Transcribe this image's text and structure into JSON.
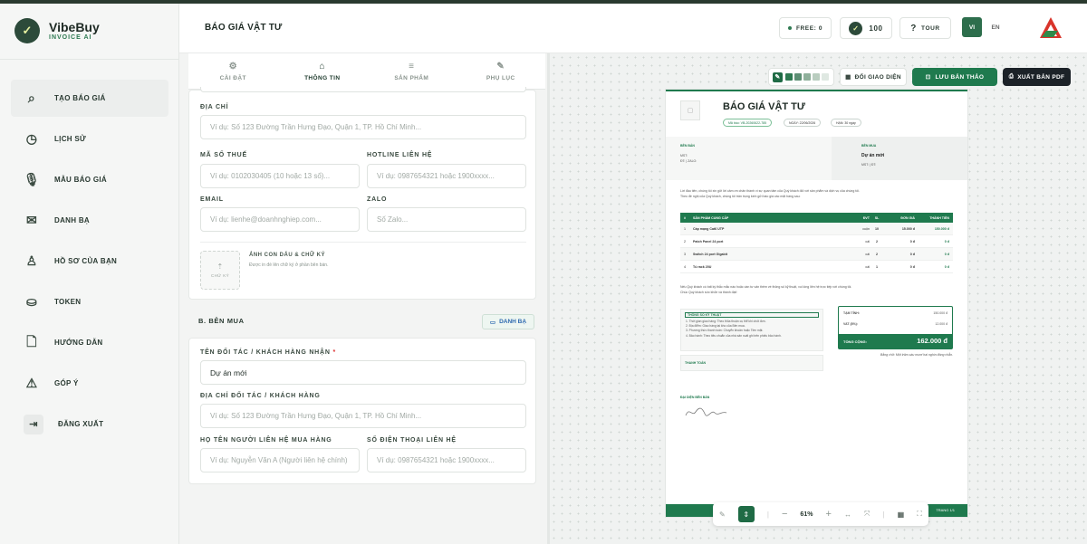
{
  "brand": {
    "name": "VibeBuy",
    "tagline": "INVOICE AI",
    "logo_glyph": "✓"
  },
  "sidebar": {
    "items": [
      {
        "label": "TẠO BÁO GIÁ",
        "icon": "search-icon",
        "glyph": "⌕"
      },
      {
        "label": "LỊCH SỬ",
        "icon": "clock-icon",
        "glyph": "◷"
      },
      {
        "label": "MẪU BÁO GIÁ",
        "icon": "microphone-icon",
        "glyph": "🎙"
      },
      {
        "label": "DANH BẠ",
        "icon": "contacts-icon",
        "glyph": "✉"
      },
      {
        "label": "HỒ SƠ CỦA BẠN",
        "icon": "user-icon",
        "glyph": "♙"
      },
      {
        "label": "TOKEN",
        "icon": "coins-icon",
        "glyph": "⛀"
      },
      {
        "label": "HƯỚNG DẪN",
        "icon": "document-icon",
        "glyph": "🗋"
      },
      {
        "label": "GÓP Ý",
        "icon": "warning-icon",
        "glyph": "⚠"
      },
      {
        "label": "ĐĂNG XUẤT",
        "icon": "logout-icon",
        "glyph": "⇥"
      }
    ]
  },
  "header": {
    "title": "BÁO GIÁ VẬT TƯ",
    "free": "FREE: 0",
    "tokens": "100",
    "tour": "TOUR",
    "lang_vi": "VI",
    "lang_en": "EN"
  },
  "tabs": [
    {
      "label": "CÀI ĐẶT",
      "glyph": "⚙"
    },
    {
      "label": "THÔNG TIN",
      "glyph": "⌂"
    },
    {
      "label": "SẢN PHẨM",
      "glyph": "≡"
    },
    {
      "label": "PHỤ LỤC",
      "glyph": "✎"
    }
  ],
  "seller": {
    "address_label": "ĐỊA CHỈ",
    "address_ph": "Ví dụ: Số 123 Đường Trần Hưng Đạo, Quận 1, TP. Hồ Chí Minh...",
    "tax_label": "MÃ SỐ THUẾ",
    "tax_ph": "Ví dụ: 0102030405 (10 hoặc 13 số)...",
    "hotline_label": "HOTLINE LIÊN HỆ",
    "hotline_ph": "Ví dụ: 0987654321 hoặc 1900xxxx...",
    "email_label": "EMAIL",
    "email_ph": "Ví dụ: lienhe@doanhnghiep.com...",
    "zalo_label": "ZALO",
    "zalo_ph": "Số Zalo...",
    "stamp_title": "ẢNH CON DẤU & CHỮ KÝ",
    "stamp_desc": "Được in đè lên chữ ký ở phần bên bán.",
    "stamp_btn": "CHỮ KÝ"
  },
  "buyer": {
    "section": "B. BÊN MUA",
    "contacts_btn": "DANH BẠ",
    "name_label": "TÊN ĐỐI TÁC / KHÁCH HÀNG NHẬN",
    "name_value": "Dự án mới",
    "addr_label": "ĐỊA CHỈ ĐỐI TÁC / KHÁCH HÀNG",
    "addr_ph": "Ví dụ: Số 123 Đường Trần Hưng Đạo, Quận 1, TP. Hồ Chí Minh...",
    "contact_label": "HỌ TÊN NGƯỜI LIÊN HỆ MUA HÀNG",
    "contact_ph": "Ví dụ: Nguyễn Văn A (Người liên hệ chính)",
    "phone_label": "SỐ ĐIỆN THOẠI LIÊN HỆ",
    "phone_ph": "Ví dụ: 0987654321 hoặc 1900xxxx..."
  },
  "preview_toolbar": {
    "theme_btn": "ĐỔI GIAO DIỆN",
    "save_btn": "LƯU BẢN THẢO",
    "pdf_btn": "XUẤT BẢN PDF",
    "swatches": [
      "#2f7a52",
      "#5d8f74",
      "#8fb09b",
      "#b9cdbf",
      "#dfe8e2"
    ]
  },
  "invoice": {
    "title": "BÁO GIÁ VẬT TƯ",
    "code": "Mã báo: VB-20260622-785",
    "date": "NGÀY: 22/06/2026",
    "valid": "HẠN: 30 ngày",
    "seller_head": "BÊN BÁN",
    "seller_l1": "MST:",
    "seller_l2": "ĐT: | ZALO:",
    "buyer_head": "BÊN MUA",
    "buyer_name": "Dự án mới",
    "buyer_l2": "MST: | ĐT:",
    "intro": "Lời đầu tiên, chúng tôi xin gửi lời cảm ơn chân thành vì sự quan tâm của Quý khách đối với sản phẩm và dịch vụ của chúng tôi.",
    "intro2": "Theo đề nghị của Quý khách, chúng tôi trân trọng kính gửi báo giá các mặt hàng sau:",
    "cols": [
      "#",
      "SẢN PHẨM CUNG CẤP",
      "ĐVT",
      "SL",
      "ĐƠN GIÁ",
      "THÀNH TIỀN"
    ],
    "rows": [
      {
        "n": "1",
        "name": "Cáp mạng Cat6 UTP",
        "unit": "cuộn",
        "qty": "10",
        "price": "15.000 đ",
        "total": "150.000 đ"
      },
      {
        "n": "2",
        "name": "Patch Panel 24 port",
        "unit": "cái",
        "qty": "2",
        "price": "0 đ",
        "total": "0 đ"
      },
      {
        "n": "3",
        "name": "Switch 24 port Gigabit",
        "unit": "cái",
        "qty": "2",
        "price": "0 đ",
        "total": "0 đ"
      },
      {
        "n": "4",
        "name": "Tủ rack 20U",
        "unit": "cái",
        "qty": "1",
        "price": "0 đ",
        "total": "0 đ"
      }
    ],
    "closing": "Nếu Quý khách có bất kỳ thắc mắc nào hoặc cần tư vấn thêm về thông số kỹ thuật, vui lòng liên hệ trực tiếp với chúng tôi.",
    "closing2": "Chúc Quý khách sức khỏe và thành đạt!",
    "terms_head": "THÔNG SỐ KỸ THUẬT",
    "terms": [
      "1. Thời gian giao hàng: Theo thỏa thuận cụ thể khi chốt đơn.",
      "2. Địa điểm: Giao hàng tại kho của Bên mua.",
      "3. Phương thức thanh toán: Chuyển khoản hoặc Tiền mặt.",
      "4. Bảo hành: Theo tiêu chuẩn của nhà sản xuất ghi trên phiếu bảo hành."
    ],
    "pay_head": "THANH TOÁN",
    "subtotal_label": "TẠM TÍNH:",
    "subtotal": "150.000 đ",
    "vat_label": "VAT (8%):",
    "vat": "12.000 đ",
    "total_label": "TỔNG CỘNG:",
    "total": "162.000 đ",
    "in_words": "Bằng chữ: Một trăm sáu mươi hai nghìn đồng chẵn.",
    "rep_label": "ĐẠI DIỆN BÊN BÁN",
    "page": "TRANG 1/1"
  },
  "zoom": {
    "level": "61%"
  }
}
